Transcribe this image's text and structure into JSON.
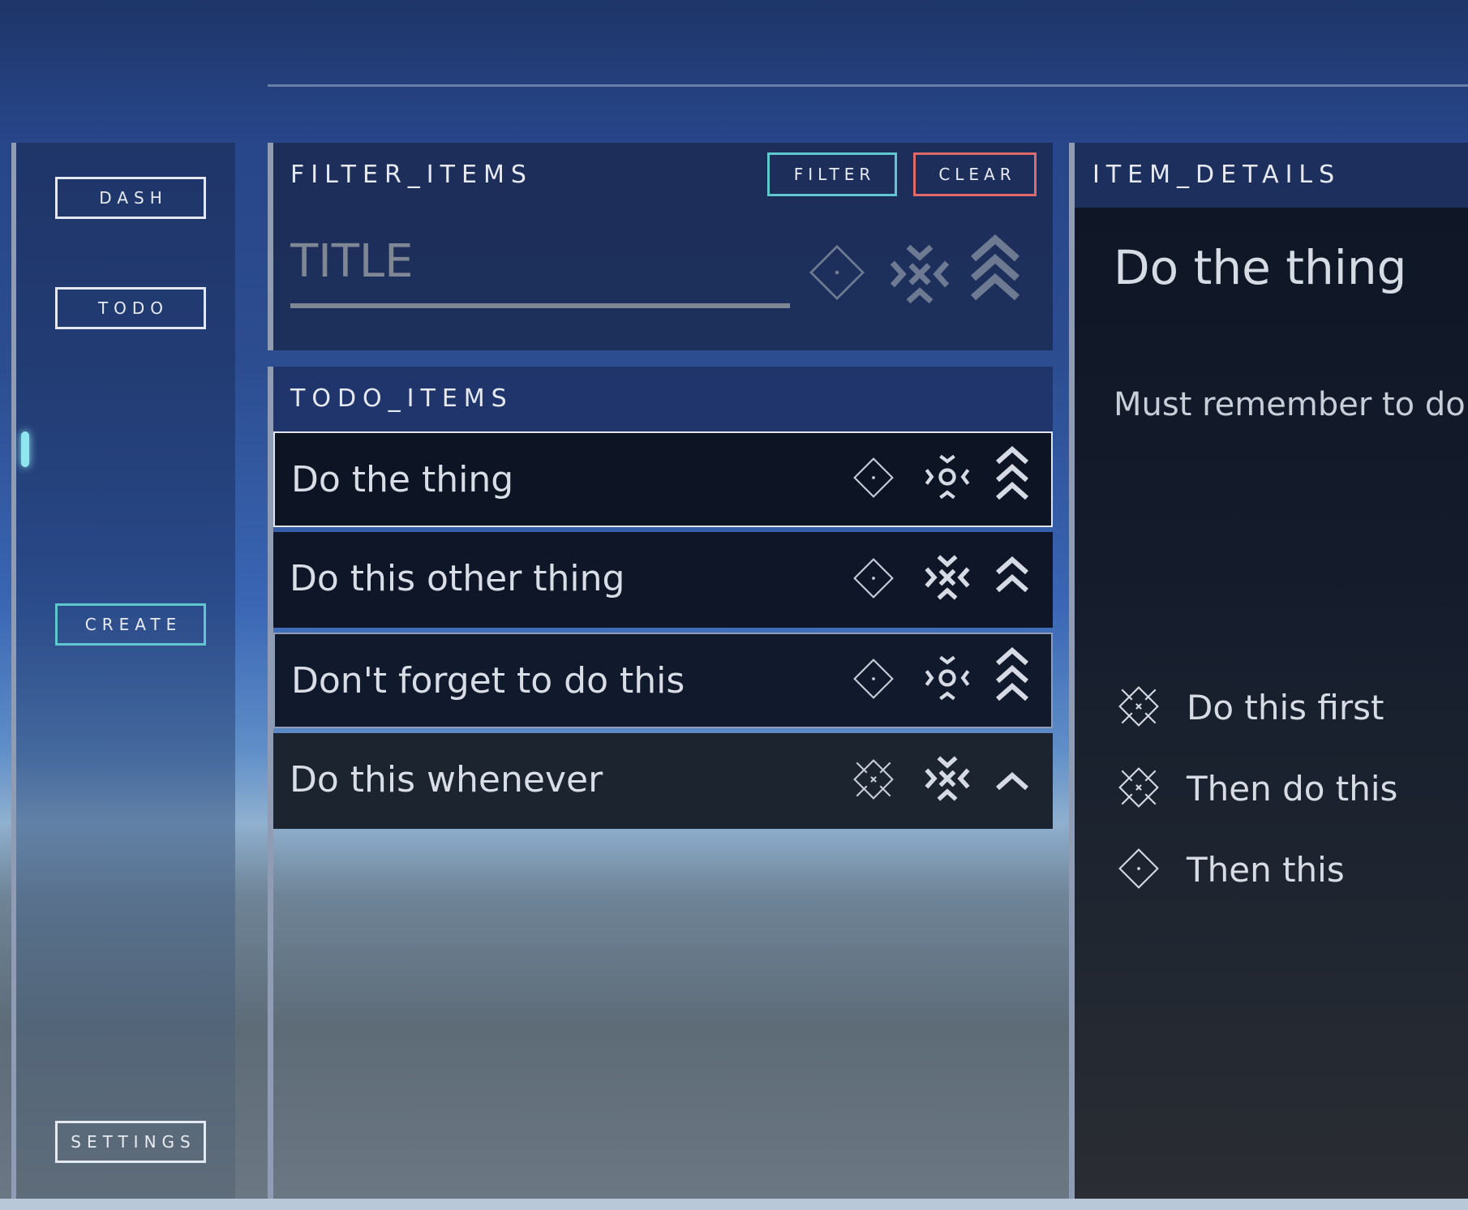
{
  "nav": {
    "dash": "DASH",
    "todo": "TODO",
    "create": "CREATE",
    "settings": "SETTINGS"
  },
  "filter_panel": {
    "title": "FILTER_ITEMS",
    "filter_button": "FILTER",
    "clear_button": "CLEAR",
    "title_placeholder": "TITLE",
    "title_value": ""
  },
  "todo_panel": {
    "title": "TODO_ITEMS",
    "items": [
      {
        "label": "Do the thing",
        "status_icon": "diamond-dot-icon",
        "effort_icon": "gear-burst-icon",
        "priority_icon": "triple-chevron-up-icon",
        "selected": true
      },
      {
        "label": "Do this other thing",
        "status_icon": "diamond-dot-icon",
        "effort_icon": "x-burst-icon",
        "priority_icon": "double-chevron-up-icon",
        "selected": false
      },
      {
        "label": "Don't forget to do this",
        "status_icon": "diamond-dot-icon",
        "effort_icon": "gear-burst-icon",
        "priority_icon": "triple-chevron-up-icon",
        "selected": false
      },
      {
        "label": "Do this whenever",
        "status_icon": "diamond-x-icon",
        "effort_icon": "x-burst-icon",
        "priority_icon": "chevron-up-icon",
        "selected": false
      }
    ]
  },
  "details_panel": {
    "title": "ITEM_DETAILS",
    "item_title": "Do the thing",
    "item_description": "Must remember to do t",
    "subtasks": [
      {
        "label": "Do this first",
        "icon": "diamond-x-icon"
      },
      {
        "label": "Then do this",
        "icon": "diamond-x-icon"
      },
      {
        "label": "Then this",
        "icon": "diamond-dot-icon"
      }
    ]
  },
  "colors": {
    "accent_teal": "#5fc8cf",
    "accent_red": "#e06a6a",
    "panel_border": "#8f9cb4"
  }
}
